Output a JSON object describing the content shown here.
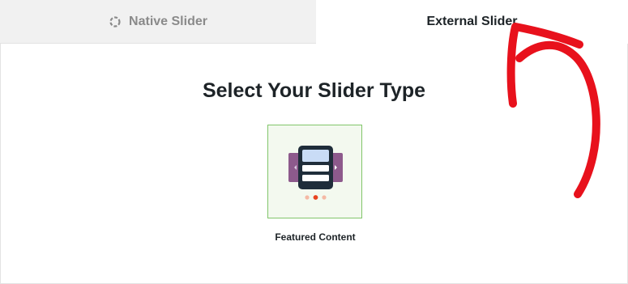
{
  "tabs": {
    "native": {
      "label": "Native Slider",
      "icon": "loading-circle-icon",
      "active": false
    },
    "external": {
      "label": "External Slider",
      "active": true
    }
  },
  "main": {
    "heading": "Select Your Slider Type",
    "options": [
      {
        "label": "Featured Content",
        "icon": "featured-content-slider-icon",
        "selected": true
      }
    ]
  },
  "annotation": {
    "icon": "red-hand-drawn-arrow-icon",
    "color": "#e8111c"
  },
  "colors": {
    "card_border": "#81c56a",
    "card_bg": "#f3f9ef",
    "slide_purple": "#8d5a8c",
    "slide_frame": "#1f2d3a",
    "slide_light": "#c9dcf6",
    "dot_active": "#e8431f",
    "dot_inactive": "#f5b9a5"
  }
}
